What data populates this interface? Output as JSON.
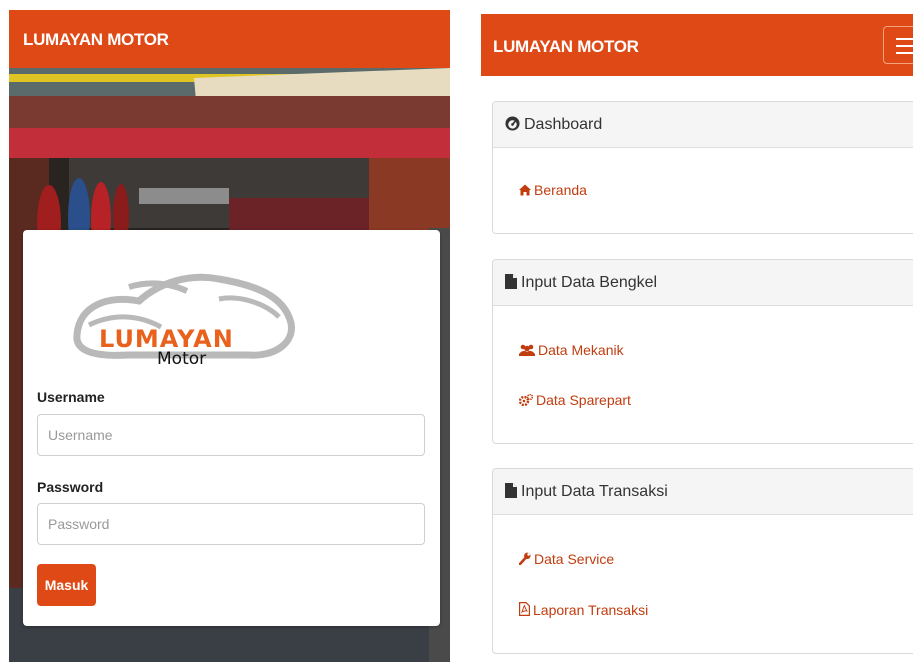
{
  "login_screen": {
    "brand": "LUMAYAN MOTOR",
    "logo": {
      "word": "LUMAYAN",
      "sub": "Motor"
    },
    "username_label": "Username",
    "username_placeholder": "Username",
    "username_value": "",
    "password_label": "Password",
    "password_placeholder": "Password",
    "password_value": "",
    "submit_label": "Masuk"
  },
  "menu_screen": {
    "brand": "LUMAYAN MOTOR",
    "panels": [
      {
        "title": "Dashboard",
        "icon": "dashboard-icon",
        "items": [
          {
            "label": "Beranda",
            "icon": "home-icon"
          }
        ]
      },
      {
        "title": "Input Data Bengkel",
        "icon": "file-icon",
        "items": [
          {
            "label": "Data Mekanik",
            "icon": "users-icon"
          },
          {
            "label": "Data Sparepart",
            "icon": "gears-icon"
          }
        ]
      },
      {
        "title": "Input Data Transaksi",
        "icon": "file-icon",
        "items": [
          {
            "label": "Data Service",
            "icon": "wrench-icon"
          },
          {
            "label": "Laporan Transaksi",
            "icon": "pdf-file-icon"
          }
        ]
      }
    ]
  },
  "colors": {
    "brand": "#de4916",
    "link": "#c13c0f",
    "panel_header": "#f5f5f5"
  }
}
